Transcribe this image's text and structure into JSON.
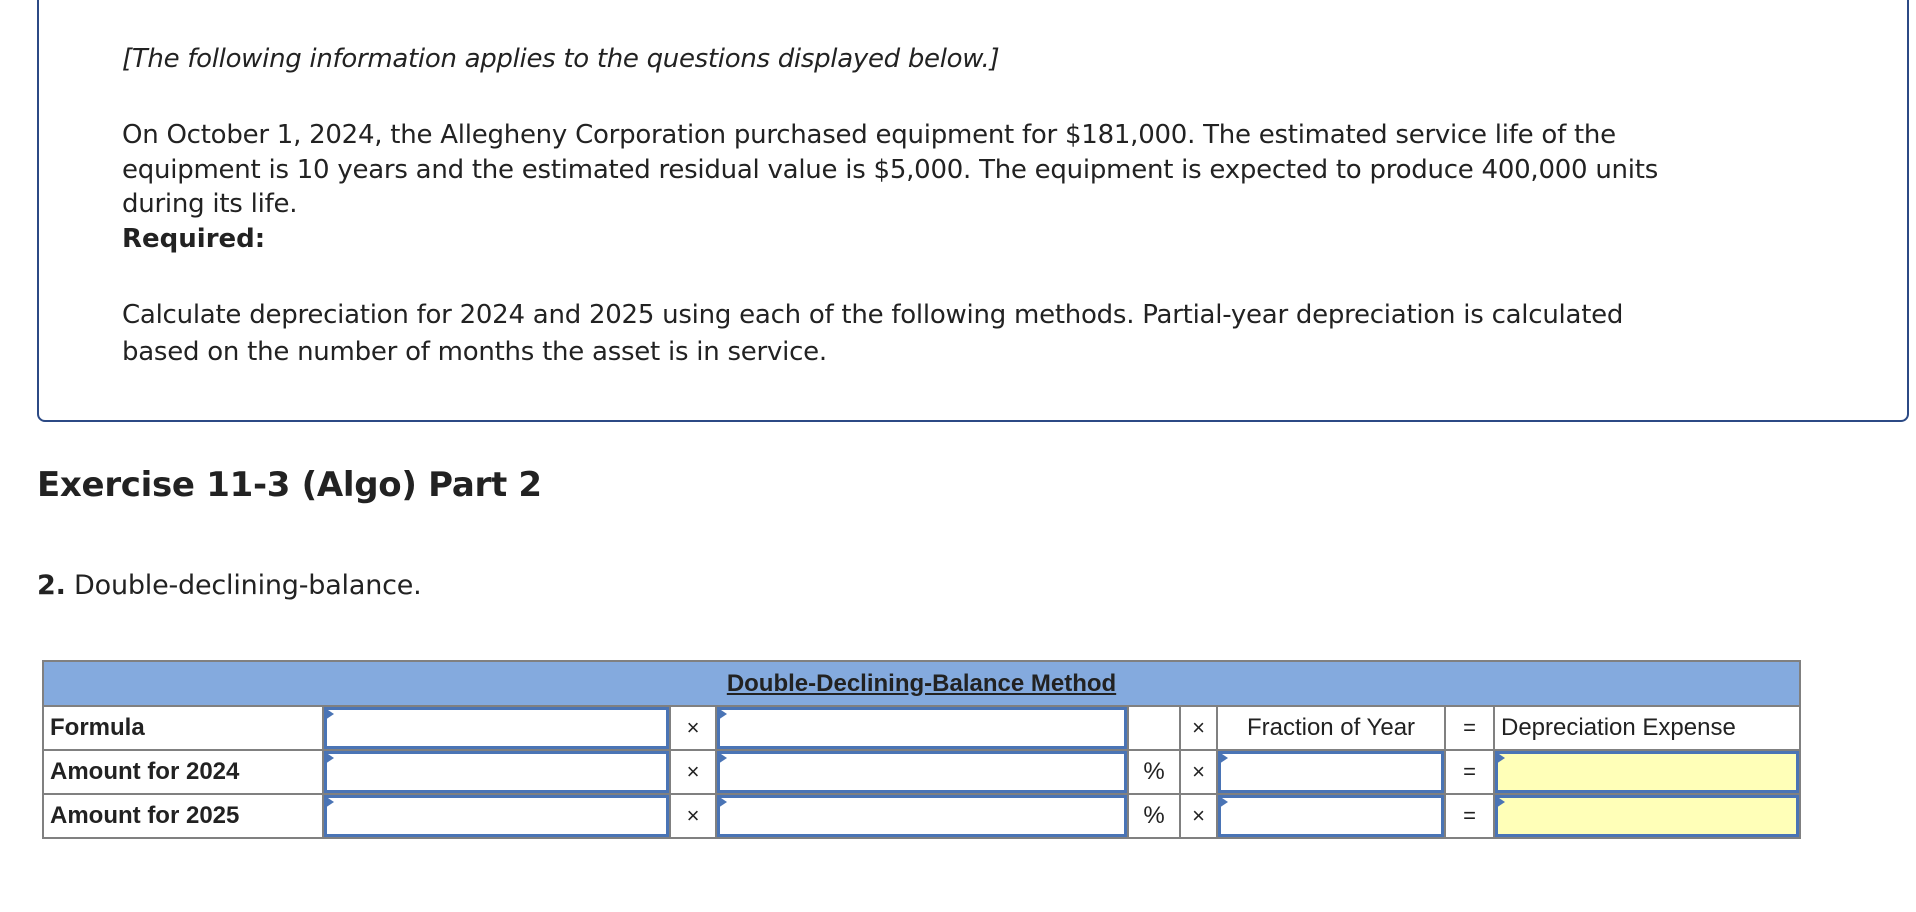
{
  "info": {
    "note": "[The following information applies to the questions displayed below.]",
    "paragraph_lines": [
      "On October 1, 2024, the Allegheny Corporation purchased equipment for $181,000. The estimated service life of the",
      "equipment is 10 years and the estimated residual value is $5,000. The equipment is expected to produce 400,000 units",
      "during its life."
    ],
    "required_label": "Required:",
    "instruction_lines": [
      "Calculate depreciation for 2024 and 2025 using each of the following methods. Partial-year depreciation is calculated",
      "based on the number of months the asset is in service."
    ]
  },
  "exercise": {
    "heading": "Exercise 11-3 (Algo) Part 2",
    "question_number": "2.",
    "question_text": " Double-declining-balance."
  },
  "table": {
    "title": "Double-Declining-Balance Method",
    "times_symbol": "×",
    "equals_symbol": "=",
    "percent_symbol": "%",
    "formula_row": {
      "label": "Formula",
      "fraction_header": "Fraction of Year",
      "result_header": "Depreciation Expense",
      "input1_value": "",
      "input2_value": ""
    },
    "rows": [
      {
        "label": "Amount for 2024",
        "book_value": "",
        "rate": "",
        "fraction": "",
        "depreciation": ""
      },
      {
        "label": "Amount for 2025",
        "book_value": "",
        "rate": "",
        "fraction": "",
        "depreciation": ""
      }
    ]
  },
  "colors": {
    "header_bg": "#84aade",
    "input_border": "#4a74b5",
    "result_fill": "#ffffb8",
    "box_border": "#2c4a85"
  }
}
